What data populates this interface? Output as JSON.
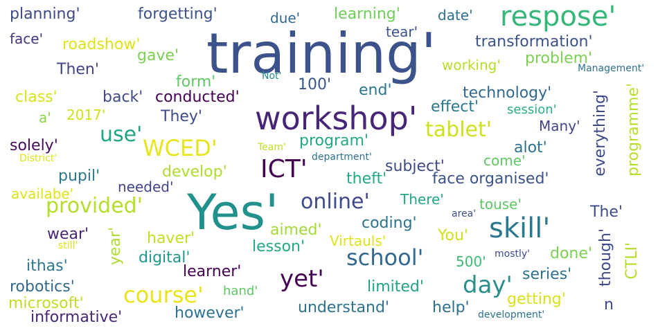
{
  "words": [
    {
      "text": "training'",
      "color": "#3b528b"
    },
    {
      "text": "Yes'",
      "color": "#21918c"
    },
    {
      "text": "workshop'",
      "color": "#482677"
    },
    {
      "text": "respose'",
      "color": "#35b779"
    },
    {
      "text": "skill'",
      "color": "#2a788e"
    },
    {
      "text": "school'",
      "color": "#31688e"
    },
    {
      "text": "provided'",
      "color": "#b5de2b"
    },
    {
      "text": "ICT'",
      "color": "#440154"
    },
    {
      "text": "WCED'",
      "color": "#e6e51a"
    },
    {
      "text": "online'",
      "color": "#3e4a89"
    },
    {
      "text": "tablet'",
      "color": "#cde11d"
    },
    {
      "text": "use'",
      "color": "#21a685"
    },
    {
      "text": "day'",
      "color": "#2a8e8c"
    },
    {
      "text": "yet'",
      "color": "#440154"
    },
    {
      "text": "course'",
      "color": "#e8e419"
    },
    {
      "text": "planning'",
      "color": "#3e4989"
    },
    {
      "text": "forgetting'",
      "color": "#3b528b"
    },
    {
      "text": "due'",
      "color": "#31688e"
    },
    {
      "text": "learning'",
      "color": "#6ece58"
    },
    {
      "text": "date'",
      "color": "#2c728e"
    },
    {
      "text": "face'",
      "color": "#46337e"
    },
    {
      "text": "roadshow'",
      "color": "#dde318"
    },
    {
      "text": "tear'",
      "color": "#3b528b"
    },
    {
      "text": "transformation'",
      "color": "#3b528b"
    },
    {
      "text": "gave'",
      "color": "#7ad151"
    },
    {
      "text": "Then'",
      "color": "#414487"
    },
    {
      "text": "form'",
      "color": "#5ec962"
    },
    {
      "text": "working'",
      "color": "#b5de2b"
    },
    {
      "text": "problem'",
      "color": "#7ad151"
    },
    {
      "text": "Not'",
      "color": "#238a8d"
    },
    {
      "text": "Management'",
      "color": "#2c728e"
    },
    {
      "text": "100'",
      "color": "#39568c"
    },
    {
      "text": "class'",
      "color": "#d8e219"
    },
    {
      "text": "back'",
      "color": "#3e4a89"
    },
    {
      "text": "conducted'",
      "color": "#440154"
    },
    {
      "text": "end'",
      "color": "#2a788e"
    },
    {
      "text": "technology'",
      "color": "#31688e"
    },
    {
      "text": "a'",
      "color": "#89d548"
    },
    {
      "text": "2017'",
      "color": "#d0e11c"
    },
    {
      "text": "They'",
      "color": "#3e4a89"
    },
    {
      "text": "effect'",
      "color": "#2a788e"
    },
    {
      "text": "session'",
      "color": "#29af7f"
    },
    {
      "text": "programme'",
      "color": "#b5de2b"
    },
    {
      "text": "solely'",
      "color": "#46085c"
    },
    {
      "text": "program'",
      "color": "#22a884"
    },
    {
      "text": "Many'",
      "color": "#414487"
    },
    {
      "text": "everything'",
      "color": "#3e4989"
    },
    {
      "text": "Team'",
      "color": "#bddf26"
    },
    {
      "text": "alot'",
      "color": "#2c728e"
    },
    {
      "text": "District'",
      "color": "#dde318"
    },
    {
      "text": "department'",
      "color": "#2c728e"
    },
    {
      "text": "subject'",
      "color": "#3e4a89"
    },
    {
      "text": "come'",
      "color": "#5ec962"
    },
    {
      "text": "pupil'",
      "color": "#2a788e"
    },
    {
      "text": "develop'",
      "color": "#addc30"
    },
    {
      "text": "theft'",
      "color": "#22a884"
    },
    {
      "text": "face organised'",
      "color": "#3b528b"
    },
    {
      "text": "availabe'",
      "color": "#dde318"
    },
    {
      "text": "needed'",
      "color": "#414487"
    },
    {
      "text": "There'",
      "color": "#21a685"
    },
    {
      "text": "touse'",
      "color": "#5ec962"
    },
    {
      "text": "area'",
      "color": "#3b528b"
    },
    {
      "text": "The'",
      "color": "#3e4a89"
    },
    {
      "text": "coding'",
      "color": "#2c728e"
    },
    {
      "text": "wear'",
      "color": "#482677"
    },
    {
      "text": "aimed'",
      "color": "#a2da37"
    },
    {
      "text": "haver'",
      "color": "#c2df23"
    },
    {
      "text": "You'",
      "color": "#d0e11c"
    },
    {
      "text": "lesson'",
      "color": "#22a884"
    },
    {
      "text": "Virtauls'",
      "color": "#dde318"
    },
    {
      "text": "still'",
      "color": "#dde318"
    },
    {
      "text": "year'",
      "color": "#addc30"
    },
    {
      "text": "digital'",
      "color": "#1f988b"
    },
    {
      "text": "500'",
      "color": "#3dbc74"
    },
    {
      "text": "mostly'",
      "color": "#3e4a89"
    },
    {
      "text": "done'",
      "color": "#7ad151"
    },
    {
      "text": "though'",
      "color": "#3e4989"
    },
    {
      "text": "CTLI'",
      "color": "#b5de2b"
    },
    {
      "text": "ithas'",
      "color": "#2a788e"
    },
    {
      "text": "learner'",
      "color": "#440154"
    },
    {
      "text": "series'",
      "color": "#2c728e"
    },
    {
      "text": "robotics'",
      "color": "#31688e"
    },
    {
      "text": "hand'",
      "color": "#5ec962"
    },
    {
      "text": "limited'",
      "color": "#20a386"
    },
    {
      "text": "microsoft'",
      "color": "#bddf26"
    },
    {
      "text": "getting'",
      "color": "#d8e219"
    },
    {
      "text": "n",
      "color": "#3e4989"
    },
    {
      "text": "understand'",
      "color": "#2c728e"
    },
    {
      "text": "help'",
      "color": "#2c728e"
    },
    {
      "text": "informative'",
      "color": "#482677"
    },
    {
      "text": "however'",
      "color": "#2c728e"
    },
    {
      "text": "development'",
      "color": "#2c728e"
    }
  ]
}
